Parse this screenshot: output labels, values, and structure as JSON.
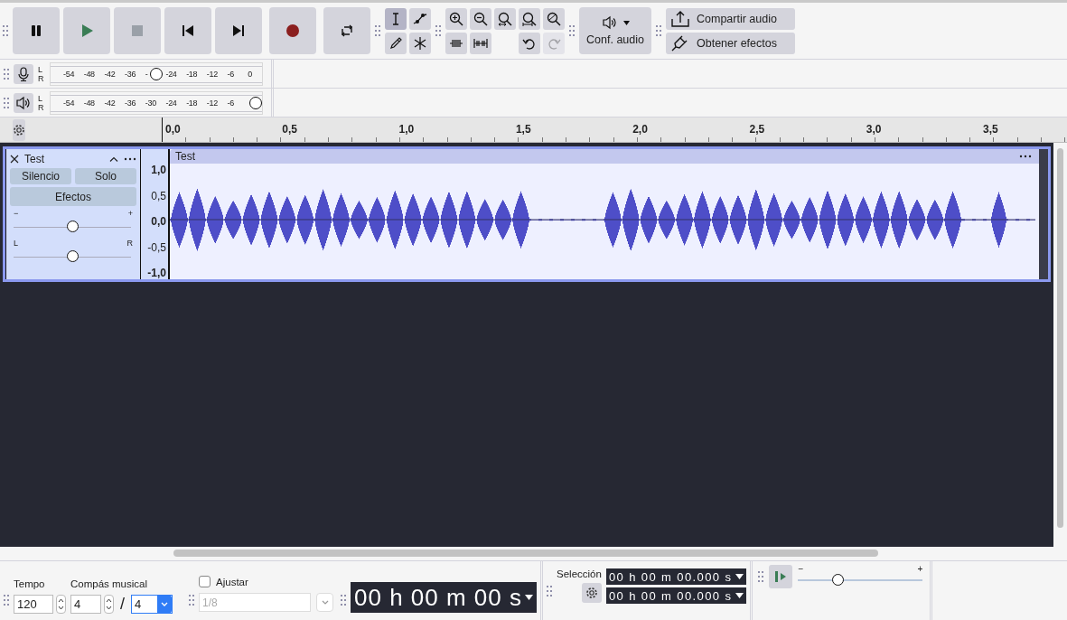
{
  "toolbar": {
    "transport_buttons": [
      {
        "kind": "pause"
      },
      {
        "kind": "play"
      },
      {
        "kind": "stop"
      },
      {
        "kind": "skip-start"
      },
      {
        "kind": "skip-end"
      },
      {
        "kind": "record"
      },
      {
        "kind": "loop"
      }
    ],
    "tools": [
      {
        "kind": "select",
        "selected": true
      },
      {
        "kind": "envelope",
        "selected": false
      },
      {
        "kind": "draw",
        "selected": false
      },
      {
        "kind": "multi",
        "selected": false
      }
    ],
    "edit_tools": [
      {
        "kind": "zoom-in",
        "disabled": false
      },
      {
        "kind": "zoom-out",
        "disabled": false
      },
      {
        "kind": "fit-selection",
        "disabled": false
      },
      {
        "kind": "fit-project",
        "disabled": false
      },
      {
        "kind": "zoom-toggle",
        "disabled": false
      },
      {
        "kind": "trim",
        "disabled": false
      },
      {
        "kind": "silence",
        "disabled": false
      },
      {
        "kind": "undo",
        "disabled": false
      },
      {
        "kind": "redo",
        "disabled": true
      }
    ],
    "audio_setup": {
      "label": "Conf. audio"
    },
    "share_audio": {
      "label": "Compartir audio"
    },
    "get_effects": {
      "label": "Obtener efectos"
    }
  },
  "meters": [
    {
      "kind": "record",
      "channels": [
        "L",
        "R"
      ],
      "ticks": [
        "-54",
        "-48",
        "-42",
        "-36",
        "-",
        "-24",
        "-18",
        "-12",
        "-6",
        "0"
      ],
      "level": 0.5
    },
    {
      "kind": "playback",
      "channels": [
        "L",
        "R"
      ],
      "ticks": [
        "-54",
        "-48",
        "-42",
        "-36",
        "-30",
        "-24",
        "-18",
        "-12",
        "-6"
      ],
      "level": 1
    }
  ],
  "ruler": {
    "labels": [
      "0,0",
      "0,5",
      "1,0",
      "1,5",
      "2,0",
      "2,5",
      "3,0",
      "3,5"
    ]
  },
  "track": {
    "name": "Test",
    "selected": true,
    "buttons": [
      "Silencio",
      "Solo"
    ],
    "effects_button": "Efectos",
    "gain": {
      "min_label": "−",
      "max_label": "+",
      "level": 0.5
    },
    "pan": {
      "min_label": "L",
      "max_label": "R",
      "level": 0.5
    },
    "scale": [
      "1,0",
      "0,5",
      "0,0",
      "-0,5",
      "-1,0"
    ],
    "clip": {
      "title": "Test"
    }
  },
  "bottom": {
    "tempo": {
      "label": "Tempo",
      "value": "120"
    },
    "time_signature": {
      "label": "Compás musical",
      "numerator": "4",
      "separator": "/",
      "denominator": "4"
    },
    "snap": {
      "label": "Ajustar",
      "checked": false,
      "value": "1/8",
      "disabled": true
    },
    "time": {
      "value": "00 h 00 m 00 s"
    },
    "selection": {
      "label": "Selección",
      "start": "00 h 00 m 00.000 s",
      "end": "00 h 00 m 00.000 s"
    },
    "play_at_speed": {
      "min_label": "−",
      "max_label": "+",
      "level": 0.32
    }
  }
}
